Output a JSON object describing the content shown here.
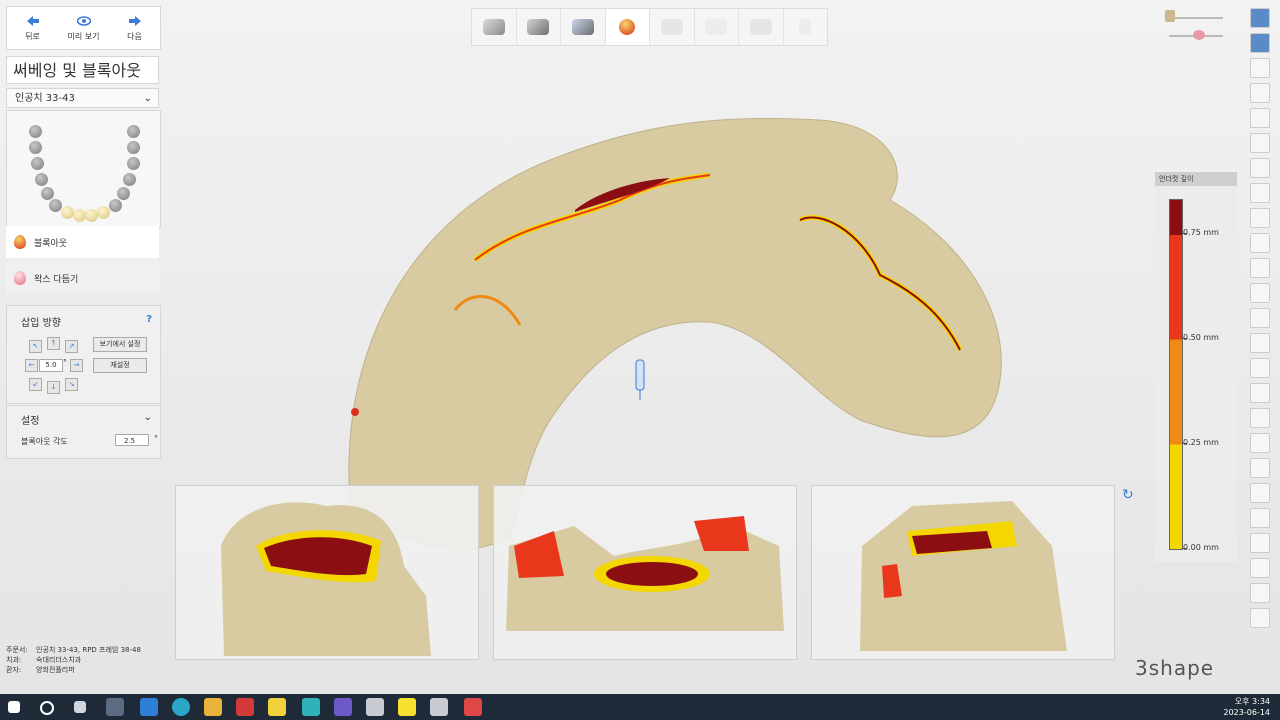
{
  "nav": {
    "back": "뒤로",
    "preview": "미리 보기",
    "next": "다음"
  },
  "title": "써베잉 및 블록아웃",
  "project": "인공치 33-43",
  "steps": [
    {
      "label": "블록아웃",
      "color": "#d9301c"
    },
    {
      "label": "왁스 다듬기",
      "color": "#e46b7d"
    }
  ],
  "insertion": {
    "header": "삽입 방향",
    "help": "?",
    "angle_value": "5.0",
    "angle_unit": "°",
    "set_from_view": "보기에서 설정",
    "reset": "재설정"
  },
  "settings": {
    "header": "설정",
    "blockout_angle_label": "블록아웃 각도",
    "blockout_angle_value": "2.5",
    "unit": "°"
  },
  "legend": {
    "title": "언더컷 깊이",
    "ticks": [
      "0.75 mm",
      "0.50 mm",
      "0.25 mm",
      "0.00 mm"
    ],
    "colors": {
      "high": "#8b0f12",
      "mid_high": "#e8371a",
      "mid": "#f08a12",
      "low": "#f4d600"
    }
  },
  "info": {
    "order_label": "주문서:",
    "order_value": "인공치 33-43, RPD 프레임 38-48",
    "clinic_label": "치과:",
    "clinic_value": "숙대리더스치과",
    "patient_label": "환자:",
    "patient_value": "양희전플리퍼"
  },
  "logo": "3shape",
  "clock": {
    "time": "오후 3:34",
    "date": "2023-06-14"
  },
  "colors": {
    "model": "#d8cba1",
    "accent": "#3a7bd5"
  },
  "taskbar_icons": [
    "windows-icon",
    "search-icon",
    "task-view-icon",
    "store-icon",
    "mail-icon",
    "edge-icon",
    "folder-icon",
    "app-red-icon",
    "sticky-notes-icon",
    "app-teal-icon",
    "app-purple-icon",
    "dental-app-icon",
    "kakao-icon",
    "dental-app-2-icon",
    "app-active-icon"
  ]
}
